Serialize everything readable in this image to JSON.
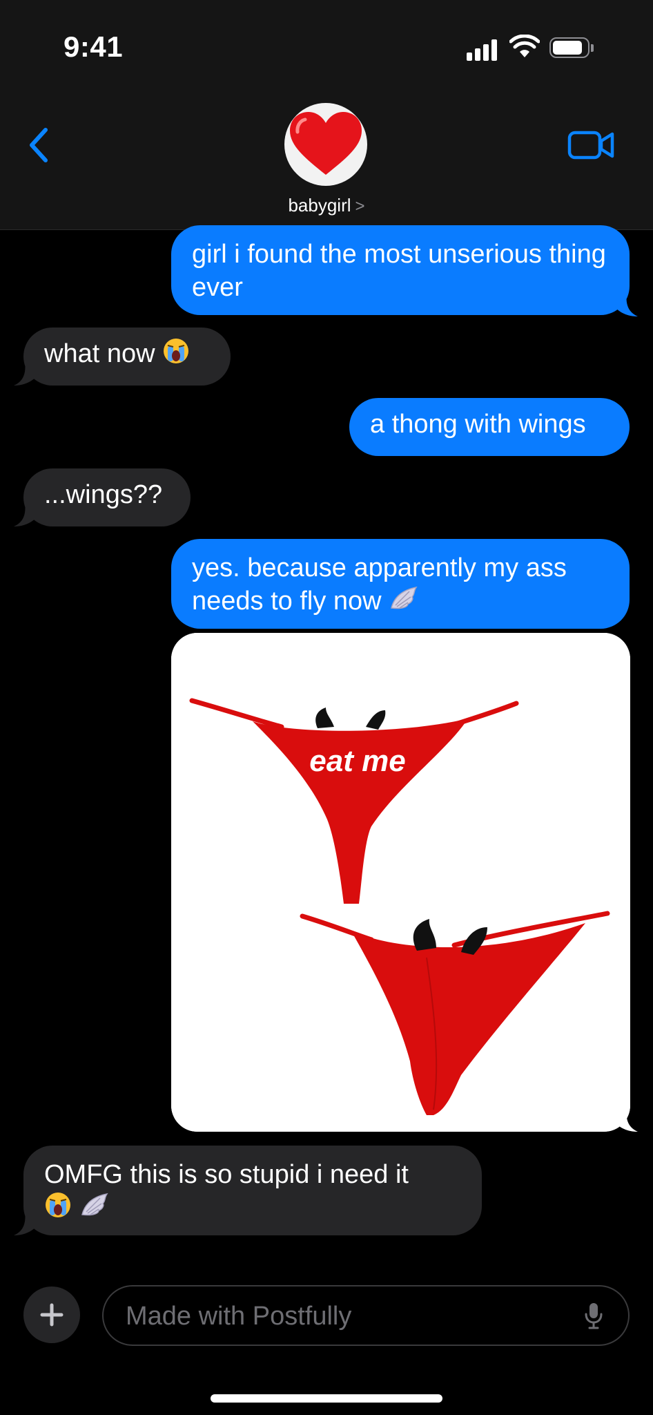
{
  "status_bar": {
    "time": "9:41"
  },
  "header": {
    "contact_name": "babygirl",
    "chevron": ">"
  },
  "messages": [
    {
      "direction": "outgoing",
      "text": "girl i found the most unserious thing ever"
    },
    {
      "direction": "incoming",
      "text": "what now"
    },
    {
      "direction": "outgoing",
      "text": "a thong with wings"
    },
    {
      "direction": "incoming",
      "text": "...wings??"
    },
    {
      "direction": "outgoing",
      "text": "yes. because apparently my ass needs to fly now"
    },
    {
      "direction": "outgoing",
      "type": "image",
      "image_text": "eat me"
    },
    {
      "direction": "incoming",
      "text": "OMFG this is so stupid i need it"
    }
  ],
  "compose": {
    "placeholder": "Made with Postfully"
  },
  "colors": {
    "outgoing": "#0a7cff",
    "incoming": "#262628",
    "header_bg": "#151515",
    "accent": "#0a84ff",
    "thong_red": "#d90d0d"
  },
  "icons": {
    "back": "chevron-left-icon",
    "video": "video-camera-icon",
    "plus": "plus-icon",
    "mic": "microphone-icon",
    "crying": "loudly-crying-face-emoji",
    "wing": "wing-emoji",
    "heart": "red-heart-emoji"
  }
}
